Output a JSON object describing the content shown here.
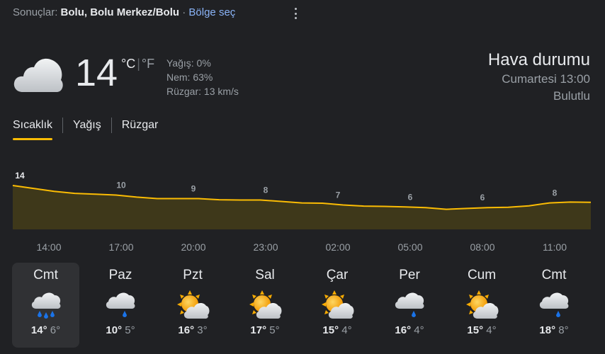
{
  "header": {
    "prefix": "Sonuçlar:",
    "location": "Bolu, Bolu Merkez/Bolu",
    "separator": " · ",
    "region_link": "Bölge seç"
  },
  "current": {
    "temp": "14",
    "unit_c": "°C",
    "unit_sep": "|",
    "unit_f": "°F",
    "precip": "Yağış: 0%",
    "humidity": "Nem: 63%",
    "wind": "Rüzgar: 13 km/s",
    "icon": "cloudy-icon"
  },
  "summary": {
    "title": "Hava durumu",
    "datetime": "Cumartesi 13:00",
    "condition": "Bulutlu"
  },
  "tabs": [
    {
      "label": "Sıcaklık",
      "active": true
    },
    {
      "label": "Yağış",
      "active": false
    },
    {
      "label": "Rüzgar",
      "active": false
    }
  ],
  "chart_data": {
    "type": "area",
    "x": [
      "14:00",
      "17:00",
      "20:00",
      "23:00",
      "02:00",
      "05:00",
      "08:00",
      "11:00"
    ],
    "labels": [
      "14",
      "10",
      "9",
      "8",
      "7",
      "6",
      "6",
      "8"
    ],
    "curve": [
      14,
      13,
      12,
      11.3,
      11,
      10.7,
      10,
      9.5,
      9.5,
      9.5,
      9.1,
      9,
      9,
      8.5,
      8,
      7.9,
      7.3,
      6.9,
      6.8,
      6.6,
      6.4,
      5.8,
      6.1,
      6.4,
      6.5,
      7,
      8,
      8.3,
      8.2
    ],
    "ylim": [
      0,
      15
    ],
    "line_color": "#fbbc04",
    "fill_color": "#3e381a"
  },
  "forecast": [
    {
      "day": "Cmt",
      "hi": "14°",
      "lo": "6°",
      "icon": "rain-heavy-icon"
    },
    {
      "day": "Paz",
      "hi": "10°",
      "lo": "5°",
      "icon": "rain-light-icon"
    },
    {
      "day": "Pzt",
      "hi": "16°",
      "lo": "3°",
      "icon": "partly-cloudy-icon"
    },
    {
      "day": "Sal",
      "hi": "17°",
      "lo": "5°",
      "icon": "partly-cloudy-icon"
    },
    {
      "day": "Çar",
      "hi": "15°",
      "lo": "4°",
      "icon": "partly-cloudy-icon"
    },
    {
      "day": "Per",
      "hi": "16°",
      "lo": "4°",
      "icon": "rain-light-icon"
    },
    {
      "day": "Cum",
      "hi": "15°",
      "lo": "4°",
      "icon": "partly-cloudy-icon"
    },
    {
      "day": "Cmt",
      "hi": "18°",
      "lo": "8°",
      "icon": "rain-light-icon"
    }
  ]
}
